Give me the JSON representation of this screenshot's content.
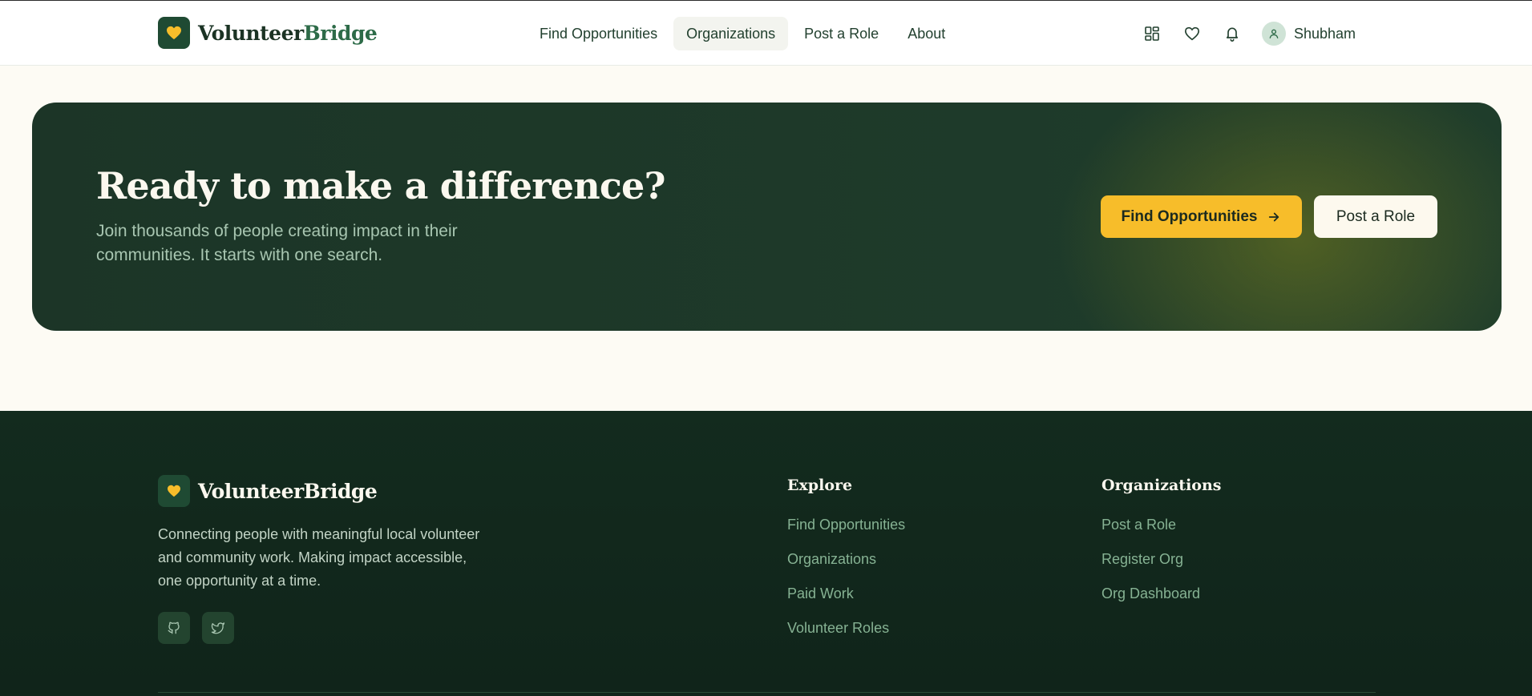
{
  "header": {
    "brand": {
      "name_part1": "Volunteer",
      "name_part2": "Bridge",
      "logo_icon": "heart-icon"
    },
    "nav": [
      {
        "label": "Find Opportunities",
        "active": false
      },
      {
        "label": "Organizations",
        "active": true
      },
      {
        "label": "Post a Role",
        "active": false
      },
      {
        "label": "About",
        "active": false
      }
    ],
    "icons": [
      "grid-icon",
      "heart-icon",
      "bell-icon"
    ],
    "user": {
      "name": "Shubham",
      "avatar_icon": "user-icon"
    }
  },
  "cta": {
    "title": "Ready to make a difference?",
    "subtitle": "Join thousands of people creating impact in their communities. It starts with one search.",
    "primary_button": "Find Opportunities",
    "secondary_button": "Post a Role"
  },
  "footer": {
    "brand": "VolunteerBridge",
    "description": "Connecting people with meaningful local volunteer and community work. Making impact accessible, one opportunity at a time.",
    "socials": [
      "github-icon",
      "twitter-icon"
    ],
    "columns": [
      {
        "title": "Explore",
        "links": [
          "Find Opportunities",
          "Organizations",
          "Paid Work",
          "Volunteer Roles"
        ]
      },
      {
        "title": "Organizations",
        "links": [
          "Post a Role",
          "Register Org",
          "Org Dashboard"
        ]
      }
    ]
  },
  "colors": {
    "brand_green": "#1f4a33",
    "accent_yellow": "#f7bd2a",
    "footer_bg": "#132b1e",
    "page_bg": "#fdfbf4"
  }
}
